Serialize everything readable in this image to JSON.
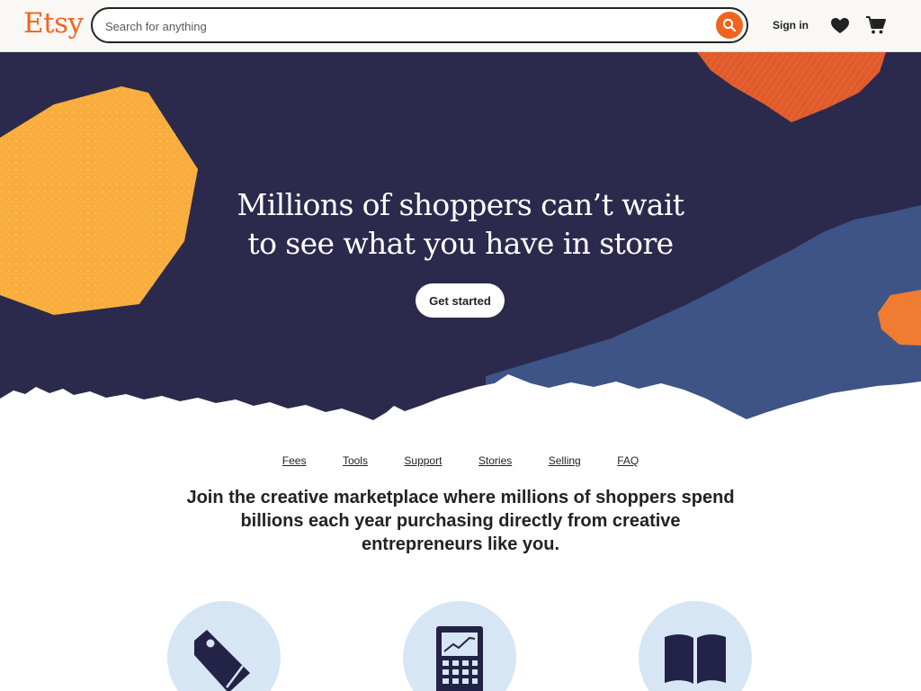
{
  "header": {
    "logo": "Etsy",
    "search_placeholder": "Search for anything",
    "signin_label": "Sign in",
    "icons": [
      "search-icon",
      "heart-icon",
      "cart-icon"
    ]
  },
  "hero": {
    "title_line1": "Millions of shoppers can’t wait",
    "title_line2": "to see what you have in store",
    "cta_label": "Get started"
  },
  "subnav": {
    "items": [
      "Fees",
      "Tools",
      "Support",
      "Stories",
      "Selling",
      "FAQ"
    ]
  },
  "intro": {
    "text": "Join the creative marketplace where millions of shoppers spend billions each year purchasing directly from creative entrepreneurs like you."
  },
  "features": {
    "icons": [
      "price-tag-icon",
      "calculator-icon",
      "book-icon"
    ]
  },
  "colors": {
    "brand": "#f1641e",
    "hero_bg": "#2b2a4c",
    "hero_blue": "#3e5486",
    "accent_yellow": "#f9ad3c",
    "feature_circle": "#d7e6f5"
  }
}
